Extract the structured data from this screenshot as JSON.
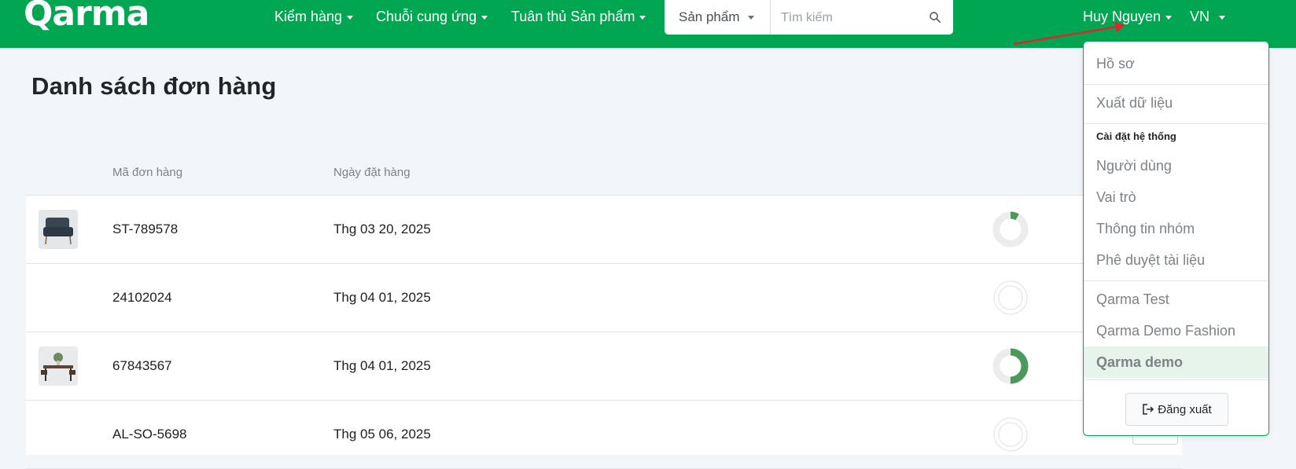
{
  "header": {
    "logo_text": "Qarma",
    "nav": [
      {
        "label": "Kiểm hàng"
      },
      {
        "label": "Chuỗi cung ứng"
      },
      {
        "label": "Tuân thủ Sản phẩm"
      }
    ],
    "search": {
      "category": "Sản phẩm",
      "placeholder": "Tìm kiếm"
    },
    "user_name": "Huy Nguyen",
    "language": "VN"
  },
  "page": {
    "title": "Danh sách đơn hàng",
    "columns": {
      "order_id": "Mã đơn hàng",
      "order_date": "Ngày đặt hàng"
    },
    "rows": [
      {
        "id": "ST-789578",
        "date": "Thg 03 20, 2025",
        "has_thumb": true,
        "progress": 0.08
      },
      {
        "id": "24102024",
        "date": "Thg 04 01, 2025",
        "has_thumb": false,
        "progress": 0
      },
      {
        "id": "67843567",
        "date": "Thg 04 01, 2025",
        "has_thumb": true,
        "progress": 0.5
      },
      {
        "id": "AL-SO-5698",
        "date": "Thg 05 06, 2025",
        "has_thumb": false,
        "progress": 0
      }
    ]
  },
  "user_menu": {
    "profile": "Hồ sơ",
    "export": "Xuất dữ liệu",
    "settings_heading": "Cài đặt hệ thống",
    "users": "Người dùng",
    "roles": "Vai trò",
    "group_info": "Thông tin nhóm",
    "doc_approval": "Phê duyệt tài liệu",
    "orgs": [
      {
        "label": "Qarma Test",
        "active": false
      },
      {
        "label": "Qarma Demo Fashion",
        "active": false
      },
      {
        "label": "Qarma demo",
        "active": true
      }
    ],
    "logout": "Đăng xuất"
  },
  "colors": {
    "brand": "#00a651",
    "progress": "#4c9a5b",
    "annotation_arrow": "#e0262b"
  }
}
